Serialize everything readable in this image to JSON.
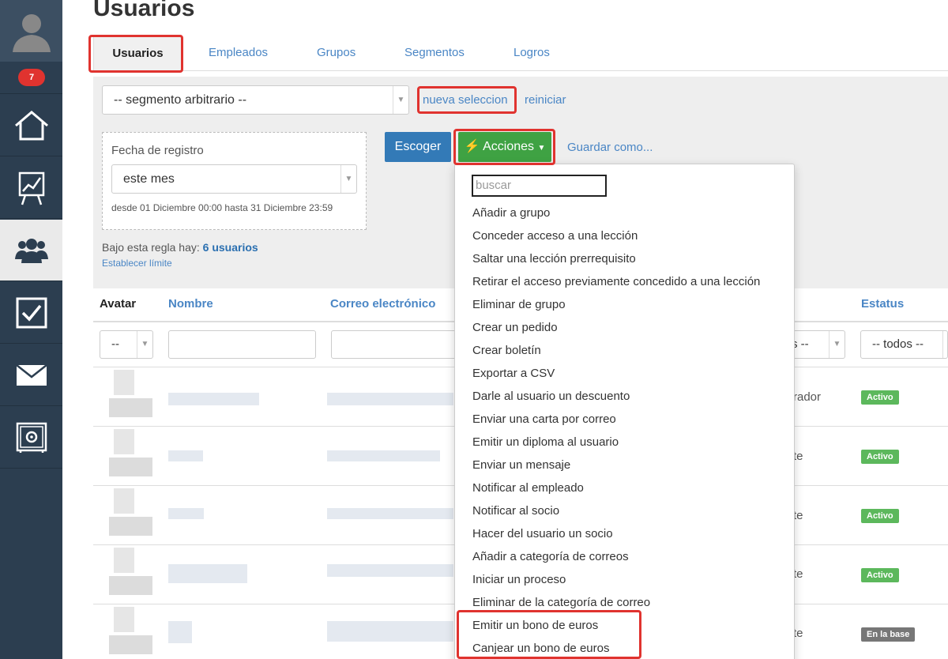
{
  "page": {
    "title": "Usuarios"
  },
  "sidebar": {
    "badge_count": "7",
    "items": [
      {
        "icon": "home-icon"
      },
      {
        "icon": "chart-easel-icon"
      },
      {
        "icon": "users-icon",
        "active": true
      },
      {
        "icon": "checkbox-icon"
      },
      {
        "icon": "mail-icon"
      },
      {
        "icon": "safe-icon"
      }
    ]
  },
  "tabs": [
    "Usuarios",
    "Empleados",
    "Grupos",
    "Segmentos",
    "Logros"
  ],
  "filters": {
    "segment_select": "-- segmento arbitrario --",
    "new_selection_link": "nueva seleccion",
    "reset_link": "reiniciar",
    "date_label": "Fecha de registro",
    "date_select": "este mes",
    "date_range": "desde 01 Diciembre 00:00 hasta 31 Diciembre 23:59",
    "rule_prefix": "Bajo esta regla hay:",
    "rule_count": "6 usuarios",
    "limit_link": "Establecer límite"
  },
  "actions": {
    "choose_button": "Escoger",
    "actions_button": "Acciones",
    "save_as_link": "Guardar como..."
  },
  "table": {
    "headers": {
      "avatar": "Avatar",
      "name": "Nombre",
      "email": "Correo electrónico",
      "status": "Estatus"
    },
    "filters": {
      "avatar_select": "--",
      "type_select_fragment": "s --",
      "status_select": "-- todos --"
    },
    "rows": [
      {
        "type_fragment": "rador",
        "status": "Activo",
        "status_color": "#5cb85c"
      },
      {
        "type_fragment": "te",
        "status": "Activo",
        "status_color": "#5cb85c"
      },
      {
        "type_fragment": "te",
        "status": "Activo",
        "status_color": "#5cb85c"
      },
      {
        "type_fragment": "te",
        "status": "Activo",
        "status_color": "#5cb85c"
      },
      {
        "type_fragment": "te",
        "status": "En la base",
        "status_color": "#777777"
      }
    ]
  },
  "dropdown": {
    "search_placeholder": "buscar",
    "items": [
      "Añadir a grupo",
      "Conceder acceso a una lección",
      "Saltar una lección prerrequisito",
      "Retirar el acceso previamente concedido a una lección",
      "Eliminar de grupo",
      "Crear un pedido",
      "Crear boletín",
      "Exportar a CSV",
      "Darle al usuario un descuento",
      "Enviar una carta por correo",
      "Emitir un diploma al usuario",
      "Enviar un mensaje",
      "Notificar al empleado",
      "Notificar al socio",
      "Hacer del usuario un socio",
      "Añadir a categoría de correos",
      "Iniciar un proceso",
      "Eliminar de la categoría de correo",
      "Emitir un bono de euros",
      "Canjear un bono de euros"
    ]
  },
  "colors": {
    "sidebar": "#2c3e50",
    "link": "#4a86c5",
    "primary": "#337ab7",
    "success": "#3fa243",
    "highlight": "#e0332f"
  }
}
